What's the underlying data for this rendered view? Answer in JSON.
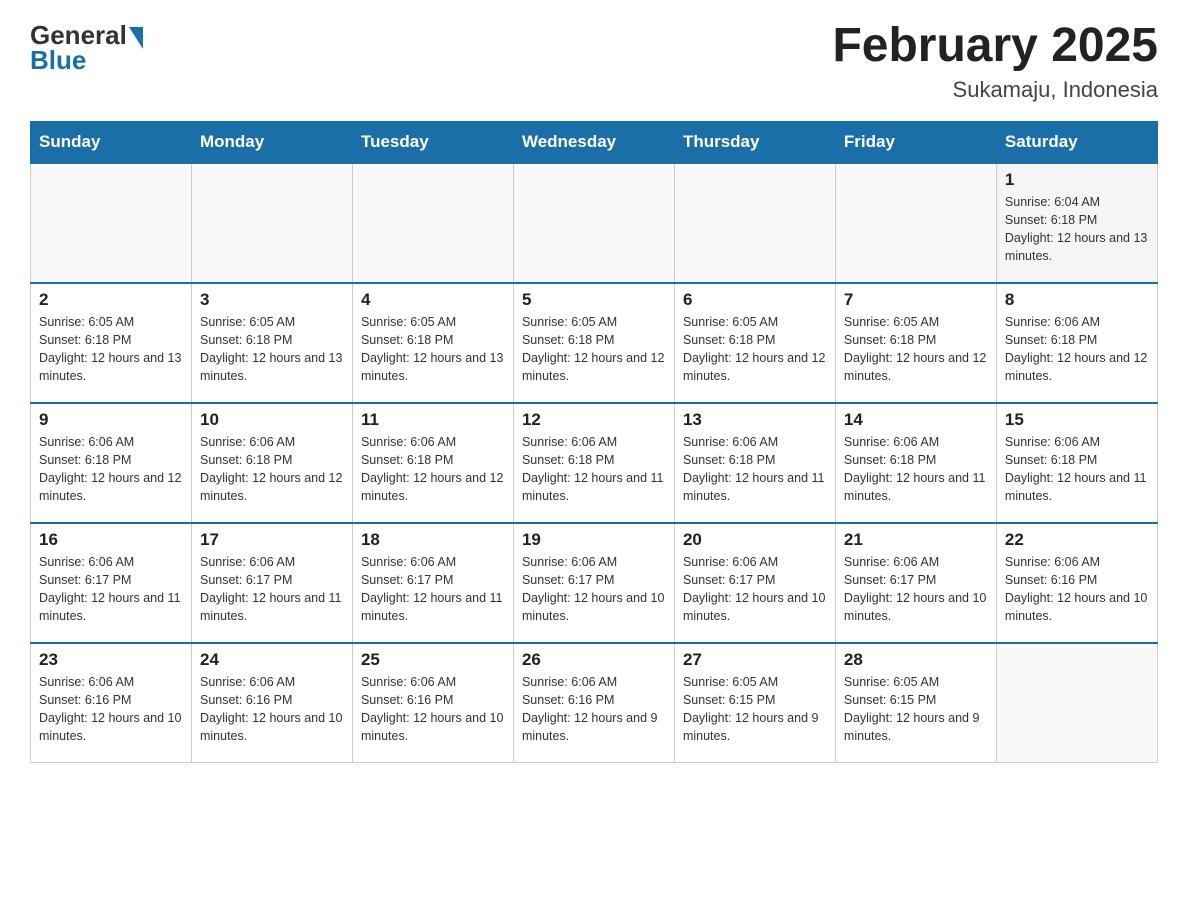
{
  "logo": {
    "general": "General",
    "blue": "Blue"
  },
  "title": {
    "month_year": "February 2025",
    "location": "Sukamaju, Indonesia"
  },
  "days_header": [
    "Sunday",
    "Monday",
    "Tuesday",
    "Wednesday",
    "Thursday",
    "Friday",
    "Saturday"
  ],
  "weeks": [
    [
      {
        "day": "",
        "sunrise": "",
        "sunset": "",
        "daylight": ""
      },
      {
        "day": "",
        "sunrise": "",
        "sunset": "",
        "daylight": ""
      },
      {
        "day": "",
        "sunrise": "",
        "sunset": "",
        "daylight": ""
      },
      {
        "day": "",
        "sunrise": "",
        "sunset": "",
        "daylight": ""
      },
      {
        "day": "",
        "sunrise": "",
        "sunset": "",
        "daylight": ""
      },
      {
        "day": "",
        "sunrise": "",
        "sunset": "",
        "daylight": ""
      },
      {
        "day": "1",
        "sunrise": "Sunrise: 6:04 AM",
        "sunset": "Sunset: 6:18 PM",
        "daylight": "Daylight: 12 hours and 13 minutes."
      }
    ],
    [
      {
        "day": "2",
        "sunrise": "Sunrise: 6:05 AM",
        "sunset": "Sunset: 6:18 PM",
        "daylight": "Daylight: 12 hours and 13 minutes."
      },
      {
        "day": "3",
        "sunrise": "Sunrise: 6:05 AM",
        "sunset": "Sunset: 6:18 PM",
        "daylight": "Daylight: 12 hours and 13 minutes."
      },
      {
        "day": "4",
        "sunrise": "Sunrise: 6:05 AM",
        "sunset": "Sunset: 6:18 PM",
        "daylight": "Daylight: 12 hours and 13 minutes."
      },
      {
        "day": "5",
        "sunrise": "Sunrise: 6:05 AM",
        "sunset": "Sunset: 6:18 PM",
        "daylight": "Daylight: 12 hours and 12 minutes."
      },
      {
        "day": "6",
        "sunrise": "Sunrise: 6:05 AM",
        "sunset": "Sunset: 6:18 PM",
        "daylight": "Daylight: 12 hours and 12 minutes."
      },
      {
        "day": "7",
        "sunrise": "Sunrise: 6:05 AM",
        "sunset": "Sunset: 6:18 PM",
        "daylight": "Daylight: 12 hours and 12 minutes."
      },
      {
        "day": "8",
        "sunrise": "Sunrise: 6:06 AM",
        "sunset": "Sunset: 6:18 PM",
        "daylight": "Daylight: 12 hours and 12 minutes."
      }
    ],
    [
      {
        "day": "9",
        "sunrise": "Sunrise: 6:06 AM",
        "sunset": "Sunset: 6:18 PM",
        "daylight": "Daylight: 12 hours and 12 minutes."
      },
      {
        "day": "10",
        "sunrise": "Sunrise: 6:06 AM",
        "sunset": "Sunset: 6:18 PM",
        "daylight": "Daylight: 12 hours and 12 minutes."
      },
      {
        "day": "11",
        "sunrise": "Sunrise: 6:06 AM",
        "sunset": "Sunset: 6:18 PM",
        "daylight": "Daylight: 12 hours and 12 minutes."
      },
      {
        "day": "12",
        "sunrise": "Sunrise: 6:06 AM",
        "sunset": "Sunset: 6:18 PM",
        "daylight": "Daylight: 12 hours and 11 minutes."
      },
      {
        "day": "13",
        "sunrise": "Sunrise: 6:06 AM",
        "sunset": "Sunset: 6:18 PM",
        "daylight": "Daylight: 12 hours and 11 minutes."
      },
      {
        "day": "14",
        "sunrise": "Sunrise: 6:06 AM",
        "sunset": "Sunset: 6:18 PM",
        "daylight": "Daylight: 12 hours and 11 minutes."
      },
      {
        "day": "15",
        "sunrise": "Sunrise: 6:06 AM",
        "sunset": "Sunset: 6:18 PM",
        "daylight": "Daylight: 12 hours and 11 minutes."
      }
    ],
    [
      {
        "day": "16",
        "sunrise": "Sunrise: 6:06 AM",
        "sunset": "Sunset: 6:17 PM",
        "daylight": "Daylight: 12 hours and 11 minutes."
      },
      {
        "day": "17",
        "sunrise": "Sunrise: 6:06 AM",
        "sunset": "Sunset: 6:17 PM",
        "daylight": "Daylight: 12 hours and 11 minutes."
      },
      {
        "day": "18",
        "sunrise": "Sunrise: 6:06 AM",
        "sunset": "Sunset: 6:17 PM",
        "daylight": "Daylight: 12 hours and 11 minutes."
      },
      {
        "day": "19",
        "sunrise": "Sunrise: 6:06 AM",
        "sunset": "Sunset: 6:17 PM",
        "daylight": "Daylight: 12 hours and 10 minutes."
      },
      {
        "day": "20",
        "sunrise": "Sunrise: 6:06 AM",
        "sunset": "Sunset: 6:17 PM",
        "daylight": "Daylight: 12 hours and 10 minutes."
      },
      {
        "day": "21",
        "sunrise": "Sunrise: 6:06 AM",
        "sunset": "Sunset: 6:17 PM",
        "daylight": "Daylight: 12 hours and 10 minutes."
      },
      {
        "day": "22",
        "sunrise": "Sunrise: 6:06 AM",
        "sunset": "Sunset: 6:16 PM",
        "daylight": "Daylight: 12 hours and 10 minutes."
      }
    ],
    [
      {
        "day": "23",
        "sunrise": "Sunrise: 6:06 AM",
        "sunset": "Sunset: 6:16 PM",
        "daylight": "Daylight: 12 hours and 10 minutes."
      },
      {
        "day": "24",
        "sunrise": "Sunrise: 6:06 AM",
        "sunset": "Sunset: 6:16 PM",
        "daylight": "Daylight: 12 hours and 10 minutes."
      },
      {
        "day": "25",
        "sunrise": "Sunrise: 6:06 AM",
        "sunset": "Sunset: 6:16 PM",
        "daylight": "Daylight: 12 hours and 10 minutes."
      },
      {
        "day": "26",
        "sunrise": "Sunrise: 6:06 AM",
        "sunset": "Sunset: 6:16 PM",
        "daylight": "Daylight: 12 hours and 9 minutes."
      },
      {
        "day": "27",
        "sunrise": "Sunrise: 6:05 AM",
        "sunset": "Sunset: 6:15 PM",
        "daylight": "Daylight: 12 hours and 9 minutes."
      },
      {
        "day": "28",
        "sunrise": "Sunrise: 6:05 AM",
        "sunset": "Sunset: 6:15 PM",
        "daylight": "Daylight: 12 hours and 9 minutes."
      },
      {
        "day": "",
        "sunrise": "",
        "sunset": "",
        "daylight": ""
      }
    ]
  ],
  "colors": {
    "header_bg": "#1a6fa8",
    "header_text": "#ffffff",
    "accent": "#1a6fa8"
  }
}
